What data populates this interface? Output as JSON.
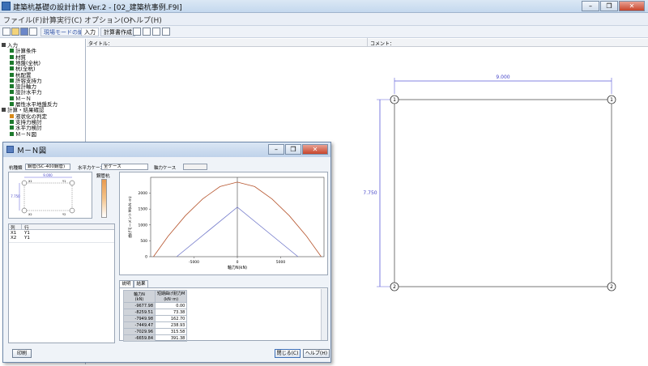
{
  "window": {
    "title": "建築杭基礎の設計計算 Ver.2 - [02_建築杭事例.F9I]",
    "controls": {
      "minimize": "–",
      "restore": "❐",
      "close": "✕"
    }
  },
  "menu": [
    {
      "label": "ファイル(F)"
    },
    {
      "label": "計算実行(C)"
    },
    {
      "label": "オプション(O)"
    },
    {
      "label": "ヘルプ(H)"
    }
  ],
  "toolbar": {
    "mode_label": "現場モードの編集",
    "input_label": "入力",
    "report_label": "計算書作成"
  },
  "header": {
    "title_label": "タイトル：",
    "comment_label": "コメント："
  },
  "tree": [
    {
      "label": "入力",
      "level": 0,
      "color": "#444444"
    },
    {
      "label": "計算条件",
      "level": 1,
      "color": "#1e7a2e"
    },
    {
      "label": "材質",
      "level": 1,
      "color": "#1e7a2e"
    },
    {
      "label": "地盤(全杭)",
      "level": 1,
      "color": "#1e7a2e"
    },
    {
      "label": "杭(全杭)",
      "level": 1,
      "color": "#1e7a2e"
    },
    {
      "label": "杭配置",
      "level": 1,
      "color": "#1e7a2e"
    },
    {
      "label": "許容支持力",
      "level": 1,
      "color": "#1e7a2e"
    },
    {
      "label": "設計軸力",
      "level": 1,
      "color": "#1e7a2e"
    },
    {
      "label": "設計水平力",
      "level": 1,
      "color": "#1e7a2e"
    },
    {
      "label": "Ｍ－Ｎ",
      "level": 1,
      "color": "#1e7a2e"
    },
    {
      "label": "層性水平地盤反力",
      "level": 1,
      "color": "#1e7a2e"
    },
    {
      "label": "計算・結果確認",
      "level": 0,
      "color": "#444444"
    },
    {
      "label": "液状化の判定",
      "level": 1,
      "color": "#d88a1a"
    },
    {
      "label": "支持力検討",
      "level": 1,
      "color": "#1e7a2e"
    },
    {
      "label": "水平力検討",
      "level": 1,
      "color": "#1e7a2e"
    },
    {
      "label": "Ｍ－Ｎ図",
      "level": 1,
      "color": "#1e7a2e"
    }
  ],
  "drawing": {
    "width_dim": "9.000",
    "height_dim": "7.750",
    "piles": [
      "1",
      "1",
      "2",
      "2"
    ]
  },
  "dialog": {
    "title": "Ｍ－Ｎ図",
    "pile_type_label": "杭種類",
    "pile_type_value": "鋼管(SC-400鋼管)",
    "horizontal_case_label": "水平力ケース",
    "horizontal_case_value": "全ケース",
    "axial_case_label": "軸力ケース",
    "axial_case_value": "",
    "mini_width": "9.000",
    "mini_height": "7.750",
    "mini_piles": [
      "X1",
      "Y1",
      "X2",
      "Y2"
    ],
    "legend_label": "鋼管杭",
    "list_headers": [
      "列",
      "行"
    ],
    "list_rows": [
      [
        "X1",
        "Y1"
      ],
      [
        "X2",
        "Y1"
      ]
    ],
    "tabs": [
      "説明",
      "結果"
    ],
    "table_headers": [
      "軸力N\n(kN)",
      "短期曲げ耐力M\n(kN･m)"
    ],
    "table_rows": [
      [
        "-9677.98",
        "0.00"
      ],
      [
        "-8259.51",
        "73.38"
      ],
      [
        "-7949.98",
        "162.70"
      ],
      [
        "-7449.47",
        "238.93"
      ],
      [
        "-7029.96",
        "315.58"
      ],
      [
        "-6659.84",
        "391.38"
      ]
    ],
    "print_button": "印刷",
    "close_button": "閉じる(C)",
    "help_button": "ヘルプ(H)"
  },
  "chart_data": {
    "type": "line",
    "title": "",
    "xlabel": "軸力N(kN)",
    "ylabel": "曲げモーメントM(kN･m)",
    "xlim": [
      -10000,
      10000
    ],
    "ylim": [
      0,
      2500
    ],
    "xticks": [
      -5000,
      0,
      5000
    ],
    "yticks": [
      0,
      500,
      1000,
      1500,
      2000
    ],
    "grid": false,
    "series": [
      {
        "color": "#b5532b",
        "x": [
          -9678,
          -8000,
          -6000,
          -4000,
          -2000,
          0,
          2000,
          4000,
          6000,
          8000,
          9678
        ],
        "y": [
          0,
          640,
          1290,
          1820,
          2210,
          2350,
          2210,
          1820,
          1290,
          640,
          0
        ]
      },
      {
        "color": "#6f76c9",
        "x": [
          -7000,
          0,
          7000
        ],
        "y": [
          0,
          1560,
          0
        ]
      }
    ]
  }
}
